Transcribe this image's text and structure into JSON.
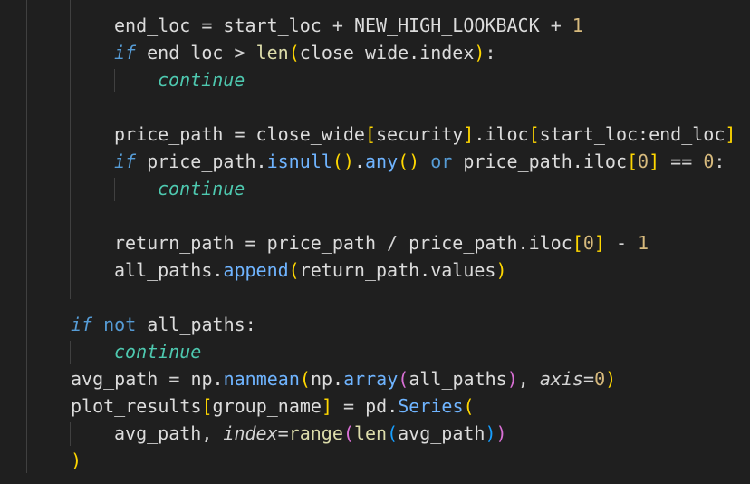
{
  "editor": {
    "theme_colors": {
      "background": "#1f1f1f",
      "variable": "#dcdcdc",
      "keyword": "#569cd6",
      "flow_keyword": "#4ec9b0",
      "number": "#d7ba7d",
      "function": "#dcdcaa",
      "method": "#6fb4ff",
      "bracket_level_1": "#ffd700",
      "bracket_level_2": "#da70d6",
      "bracket_level_3": "#179fff"
    },
    "lines": [
      {
        "tokens": [
          {
            "t": "end_loc ",
            "c": "c-var"
          },
          {
            "t": "= ",
            "c": "c-op"
          },
          {
            "t": "start_loc ",
            "c": "c-var"
          },
          {
            "t": "+ ",
            "c": "c-op"
          },
          {
            "t": "NEW_HIGH_LOOKBACK ",
            "c": "c-var"
          },
          {
            "t": "+ ",
            "c": "c-op"
          },
          {
            "t": "1",
            "c": "c-num"
          }
        ]
      },
      {
        "tokens": [
          {
            "t": "if",
            "c": "c-kw"
          },
          {
            "t": " end_loc ",
            "c": "c-var"
          },
          {
            "t": "> ",
            "c": "c-op"
          },
          {
            "t": "len",
            "c": "c-builtin"
          },
          {
            "t": "(",
            "c": "c-b1"
          },
          {
            "t": "close_wide.index",
            "c": "c-var"
          },
          {
            "t": ")",
            "c": "c-b1"
          },
          {
            "t": ":",
            "c": "c-op"
          }
        ]
      },
      {
        "tokens": [
          {
            "t": "continue",
            "c": "c-flow"
          }
        ]
      },
      {
        "tokens": []
      },
      {
        "tokens": [
          {
            "t": "price_path ",
            "c": "c-var"
          },
          {
            "t": "= ",
            "c": "c-op"
          },
          {
            "t": "close_wide",
            "c": "c-var"
          },
          {
            "t": "[",
            "c": "c-b1"
          },
          {
            "t": "security",
            "c": "c-var"
          },
          {
            "t": "]",
            "c": "c-b1"
          },
          {
            "t": ".iloc",
            "c": "c-var"
          },
          {
            "t": "[",
            "c": "c-b1"
          },
          {
            "t": "start_loc:end_loc",
            "c": "c-var"
          },
          {
            "t": "]",
            "c": "c-b1"
          }
        ]
      },
      {
        "tokens": [
          {
            "t": "if",
            "c": "c-kw"
          },
          {
            "t": " price_path.",
            "c": "c-var"
          },
          {
            "t": "isnull",
            "c": "c-method"
          },
          {
            "t": "()",
            "c": "c-b1"
          },
          {
            "t": ".",
            "c": "c-var"
          },
          {
            "t": "any",
            "c": "c-method"
          },
          {
            "t": "()",
            "c": "c-b1"
          },
          {
            "t": " or ",
            "c": "c-kw2"
          },
          {
            "t": "price_path.iloc",
            "c": "c-var"
          },
          {
            "t": "[",
            "c": "c-b1"
          },
          {
            "t": "0",
            "c": "c-num"
          },
          {
            "t": "]",
            "c": "c-b1"
          },
          {
            "t": " == ",
            "c": "c-op"
          },
          {
            "t": "0",
            "c": "c-num"
          },
          {
            "t": ":",
            "c": "c-op"
          }
        ]
      },
      {
        "tokens": [
          {
            "t": "continue",
            "c": "c-flow"
          }
        ]
      },
      {
        "tokens": []
      },
      {
        "tokens": [
          {
            "t": "return_path ",
            "c": "c-var"
          },
          {
            "t": "= ",
            "c": "c-op"
          },
          {
            "t": "price_path ",
            "c": "c-var"
          },
          {
            "t": "/ ",
            "c": "c-op"
          },
          {
            "t": "price_path.iloc",
            "c": "c-var"
          },
          {
            "t": "[",
            "c": "c-b1"
          },
          {
            "t": "0",
            "c": "c-num"
          },
          {
            "t": "]",
            "c": "c-b1"
          },
          {
            "t": " - ",
            "c": "c-op"
          },
          {
            "t": "1",
            "c": "c-num"
          }
        ]
      },
      {
        "tokens": [
          {
            "t": "all_paths.",
            "c": "c-var"
          },
          {
            "t": "append",
            "c": "c-method"
          },
          {
            "t": "(",
            "c": "c-b1"
          },
          {
            "t": "return_path.values",
            "c": "c-var"
          },
          {
            "t": ")",
            "c": "c-b1"
          }
        ]
      },
      {
        "tokens": []
      },
      {
        "tokens": [
          {
            "t": "if",
            "c": "c-kw"
          },
          {
            "t": " not",
            "c": "c-kw2"
          },
          {
            "t": " all_paths",
            "c": "c-var"
          },
          {
            "t": ":",
            "c": "c-op"
          }
        ]
      },
      {
        "tokens": [
          {
            "t": "continue",
            "c": "c-flow"
          }
        ]
      },
      {
        "tokens": [
          {
            "t": "avg_path ",
            "c": "c-var"
          },
          {
            "t": "= ",
            "c": "c-op"
          },
          {
            "t": "np.",
            "c": "c-var"
          },
          {
            "t": "nanmean",
            "c": "c-method"
          },
          {
            "t": "(",
            "c": "c-b1"
          },
          {
            "t": "np.",
            "c": "c-var"
          },
          {
            "t": "array",
            "c": "c-method"
          },
          {
            "t": "(",
            "c": "c-b2"
          },
          {
            "t": "all_paths",
            "c": "c-var"
          },
          {
            "t": ")",
            "c": "c-b2"
          },
          {
            "t": ", ",
            "c": "c-op"
          },
          {
            "t": "axis",
            "c": "c-param"
          },
          {
            "t": "=",
            "c": "c-op"
          },
          {
            "t": "0",
            "c": "c-num"
          },
          {
            "t": ")",
            "c": "c-b1"
          }
        ]
      },
      {
        "tokens": [
          {
            "t": "plot_results",
            "c": "c-var"
          },
          {
            "t": "[",
            "c": "c-b1"
          },
          {
            "t": "group_name",
            "c": "c-var"
          },
          {
            "t": "]",
            "c": "c-b1"
          },
          {
            "t": " = ",
            "c": "c-op"
          },
          {
            "t": "pd.",
            "c": "c-var"
          },
          {
            "t": "Series",
            "c": "c-method"
          },
          {
            "t": "(",
            "c": "c-b1"
          }
        ]
      },
      {
        "tokens": [
          {
            "t": "avg_path, ",
            "c": "c-var"
          },
          {
            "t": "index",
            "c": "c-param"
          },
          {
            "t": "=",
            "c": "c-op"
          },
          {
            "t": "range",
            "c": "c-builtin"
          },
          {
            "t": "(",
            "c": "c-b2"
          },
          {
            "t": "len",
            "c": "c-builtin"
          },
          {
            "t": "(",
            "c": "c-b3"
          },
          {
            "t": "avg_path",
            "c": "c-var"
          },
          {
            "t": ")",
            "c": "c-b3"
          },
          {
            "t": ")",
            "c": "c-b2"
          }
        ]
      },
      {
        "tokens": [
          {
            "t": ")",
            "c": "c-b1"
          }
        ]
      }
    ]
  }
}
